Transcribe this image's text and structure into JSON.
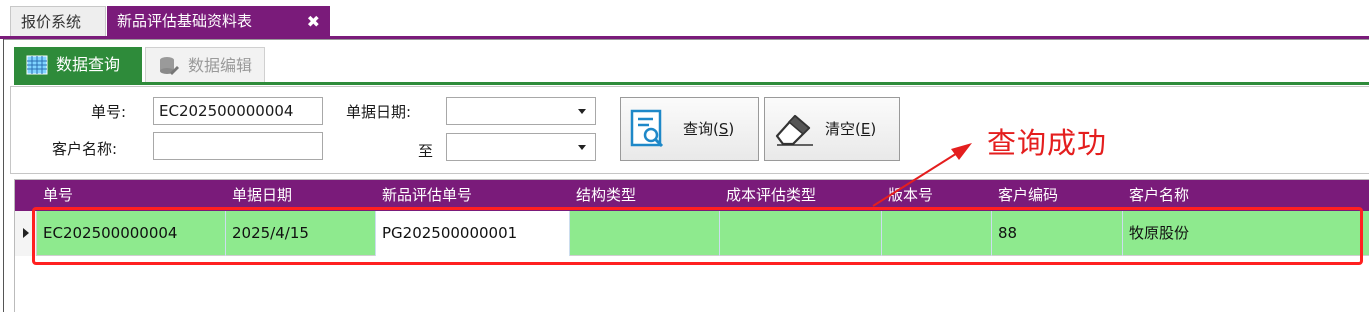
{
  "doc_tabs": [
    {
      "label": "报价系统"
    },
    {
      "label": "新品评估基础资料表",
      "close_glyph": "✖"
    }
  ],
  "sub_tabs": [
    {
      "label": "数据查询",
      "icon": "grid-icon"
    },
    {
      "label": "数据编辑",
      "icon": "database-icon"
    }
  ],
  "filters": {
    "order_no_label": "单号:",
    "order_no_value": "EC202500000004",
    "customer_label": "客户名称:",
    "customer_value": "",
    "date_label": "单据日期:",
    "date_from": "",
    "to_label": "至",
    "date_to": ""
  },
  "buttons": {
    "query": {
      "text": "查询(",
      "key": "S",
      "end": ")",
      "icon": "search-document-icon"
    },
    "clear": {
      "text": "清空(",
      "key": "E",
      "end": ")",
      "icon": "eraser-icon"
    }
  },
  "grid": {
    "columns": [
      "单号",
      "单据日期",
      "新品评估单号",
      "结构类型",
      "成本评估类型",
      "版本号",
      "客户编码",
      "客户名称"
    ],
    "rows": [
      [
        "EC202500000004",
        "2025/4/15",
        "PG202500000001",
        "",
        "",
        "",
        "88",
        "牧原股份"
      ]
    ]
  },
  "annotation": {
    "text": "查询成功",
    "color": "#e41e1e"
  },
  "colors": {
    "accent_purple": "#7a1b7a",
    "accent_green": "#2e8b3a",
    "row_green": "#8eea8e",
    "annotation_red": "#ff2020"
  }
}
